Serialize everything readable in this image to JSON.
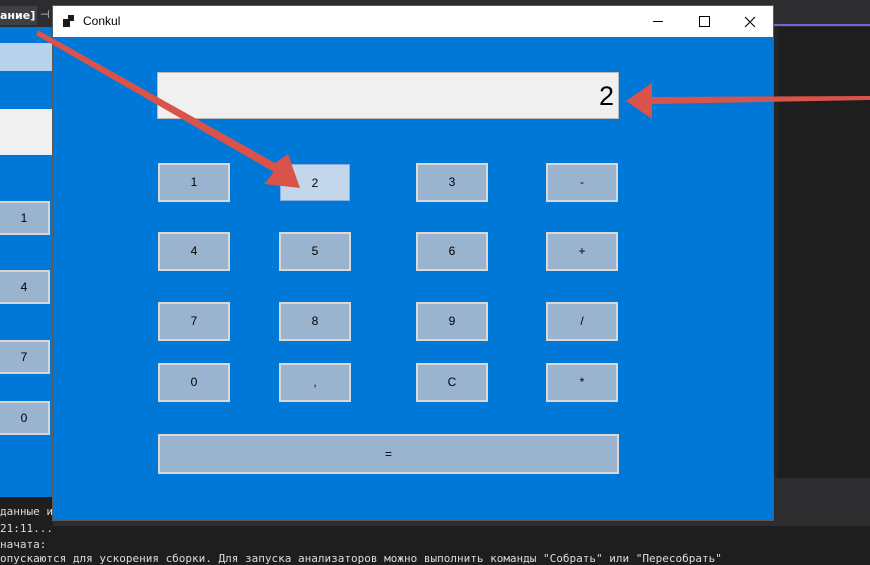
{
  "ide": {
    "tab_label": "ание]",
    "pin_glyph": "⊣",
    "output_lines": [
      "данные и",
      " 21:11...",
      " начата:",
      "опускаются для ускорения сборки. Для запуска анализаторов можно выполнить команды \"Собрать\" или \"Пересобрать\""
    ]
  },
  "background_app": {
    "buttons": [
      "1",
      "4",
      "7",
      "0"
    ]
  },
  "window": {
    "title": "Conkul",
    "display_value": "2",
    "buttons": {
      "b1": "1",
      "b2": "2",
      "b3": "3",
      "minus": "-",
      "b4": "4",
      "b5": "5",
      "b6": "6",
      "plus": "+",
      "b7": "7",
      "b8": "8",
      "b9": "9",
      "divide": "/",
      "b0": "0",
      "comma": ",",
      "clear": "C",
      "multiply": "*",
      "equals": "="
    }
  },
  "colors": {
    "window_bg": "#0078d7",
    "button_bg": "#9ab3cf",
    "arrow": "#d9534a"
  }
}
